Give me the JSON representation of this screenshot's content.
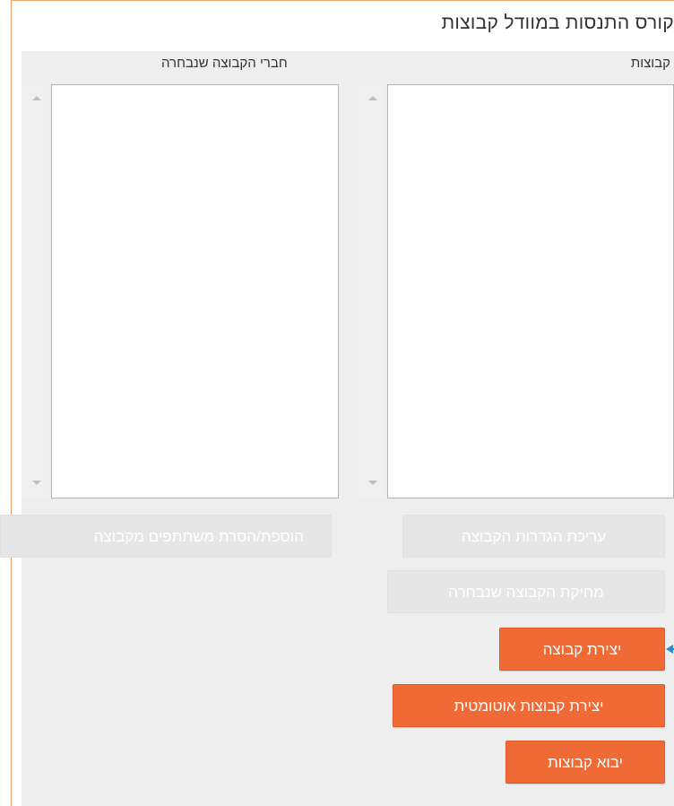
{
  "page": {
    "title": "קורס התנסות במוודל קבוצות"
  },
  "groups_column": {
    "label": "קבוצות",
    "items": []
  },
  "members_column": {
    "label": "חברי הקבוצה שנבחרה",
    "items": []
  },
  "buttons": {
    "edit_group_settings": "עריכת הגדרות הקבוצה",
    "delete_selected_group": "מחיקת הקבוצה שנבחרה",
    "add_remove_participants": "הוספת/הסרת משתתפים מקבוצה",
    "create_group": "יצירת קבוצה",
    "auto_create_groups": "יצירת קבוצות אוטומטית",
    "import_groups": "יבוא קבוצות"
  },
  "icons": {
    "pointer": "arrow-pointer-icon",
    "scroll_up": "scroll-up-arrow-icon",
    "scroll_down": "scroll-down-arrow-icon"
  },
  "colors": {
    "primary_button": "#f06a36",
    "disabled_button": "#e6e6e6",
    "panel_background": "#eeeeee",
    "frame_border": "#f0a36a",
    "pointer": "#2a8dc9"
  }
}
